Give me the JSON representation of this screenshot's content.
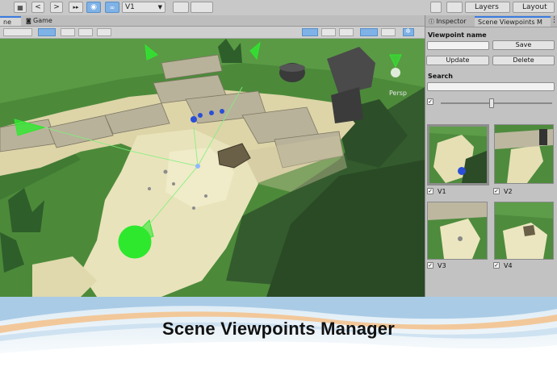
{
  "toolbar": {
    "layers_label": "Layers",
    "layout_label": "Layout",
    "viewpoint_select": "V1",
    "play_glyph": ">",
    "back_glyph": "<",
    "step_glyph": "▸▸"
  },
  "scene": {
    "tabs": [
      {
        "label": "ne"
      },
      {
        "label": "Game"
      }
    ],
    "persp_label": "Persp"
  },
  "inspector": {
    "tabs": [
      {
        "label": "Inspector"
      },
      {
        "label": "Scene Viewpoints M"
      }
    ],
    "viewpoint_name_label": "Viewpoint name",
    "viewpoint_name_value": "",
    "save_label": "Save",
    "update_label": "Update",
    "delete_label": "Delete",
    "search_label": "Search",
    "search_value": "",
    "toggle_checked": "✓",
    "thumb_size_value": 0.47,
    "viewpoints": [
      {
        "name": "V1",
        "checked": "✓",
        "selected": true
      },
      {
        "name": "V2",
        "checked": "✓",
        "selected": false
      },
      {
        "name": "V3",
        "checked": "✓",
        "selected": false
      },
      {
        "name": "V4",
        "checked": "✓",
        "selected": false
      }
    ]
  },
  "banner": {
    "title": "Scene Viewpoints Manager"
  },
  "colors": {
    "accent_blue": "#7fb2e6",
    "grass": "#4f8a3e",
    "sand": "#e8e2b8",
    "camera_gizmo": "#2ee82e"
  }
}
